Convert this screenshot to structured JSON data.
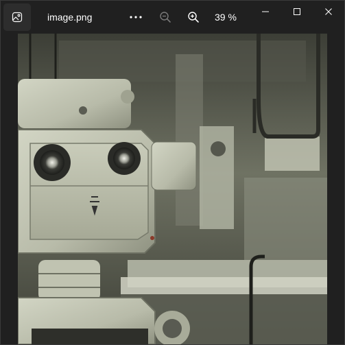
{
  "window": {
    "title": "image.png",
    "zoom_level": "39 %"
  },
  "toolbar": {
    "app_icon": "gallery-icon",
    "more_icon": "more-options-icon",
    "zoom_out_icon": "zoom-out-icon",
    "zoom_in_icon": "zoom-in-icon"
  },
  "window_controls": {
    "minimize_icon": "minimize-icon",
    "maximize_icon": "maximize-icon",
    "close_icon": "close-icon"
  },
  "image": {
    "subject_icon": "robot-photo"
  },
  "colors": {
    "titlebar_bg": "#202020",
    "text": "#ffffff",
    "disabled_icon": "#7a7a7a"
  }
}
